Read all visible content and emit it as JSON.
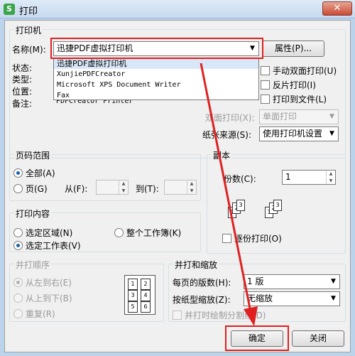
{
  "window": {
    "title": "打印",
    "app_icon": "S",
    "close": "✕"
  },
  "printer": {
    "group_title": "打印机",
    "name_label": "名称(M):",
    "selected": "迅捷PDF虚拟打印机",
    "options": [
      "迅捷PDF虚拟打印机",
      "XunjiePDFCreator",
      "Microsoft XPS Document Writer",
      "Fax"
    ],
    "properties_button": "属性(P)...",
    "status_label": "状态:",
    "type_label": "类型:",
    "location_label": "位置:",
    "comment_label": "备注:",
    "comment_value": "PDFCreator Printer",
    "manual_duplex": "手动双面打印(U)",
    "reverse_print": "反片打印(I)",
    "print_to_file": "打印到文件(L)",
    "duplex_label": "双面打印(X):",
    "duplex_value": "单面打印",
    "paper_source_label": "纸张来源(S):",
    "paper_source_value": "使用打印机设置"
  },
  "page_range": {
    "title": "页码范围",
    "all": "全部(A)",
    "pages": "页(G)",
    "from": "从(F):",
    "to": "到(T):"
  },
  "copies": {
    "title": "副本",
    "count_label": "份数(C):",
    "count_value": "1",
    "collate": "逐份打印(O)"
  },
  "print_content": {
    "title": "打印内容",
    "selection": "选定区域(N)",
    "whole_workbook": "整个工作簿(K)",
    "selected_sheets": "选定工作表(V)"
  },
  "print_order": {
    "title": "并打顺序",
    "left_to_right": "从左到右(E)",
    "top_to_bottom": "从上到下(B)",
    "repeat": "重复(R)"
  },
  "zoom": {
    "title": "并打和缩放",
    "pages_per_sheet_label": "每页的版数(H):",
    "pages_per_sheet_value": "1 版",
    "scale_label": "按纸型缩放(Z):",
    "scale_value": "无缩放",
    "draw_dividers": "并打时绘制分割线(D)"
  },
  "buttons": {
    "ok": "确定",
    "close": "关闭"
  },
  "colors": {
    "highlight": "#e02020",
    "accent": "#1c5fa8"
  }
}
